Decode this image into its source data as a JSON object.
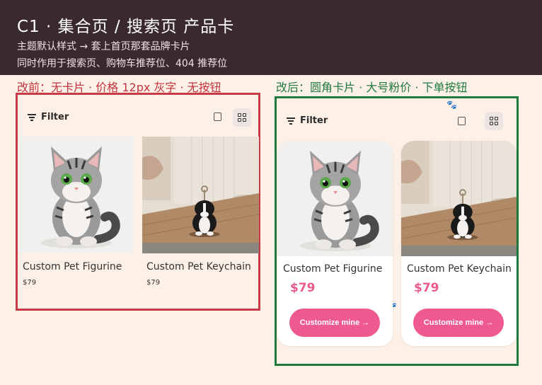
{
  "header": {
    "title": "C1 ·  集合页 / 搜索页 产品卡",
    "subtitle1": "主题默认样式 → 套上首页那套品牌卡片",
    "subtitle2": "同时作用于搜索页、购物车推荐位、404 推荐位"
  },
  "labels": {
    "before": "改前：无卡片 ·  价格 12px 灰字 ·  无按钮",
    "after": "改后：圆角卡片 ·  大号粉价 ·  下单按钮"
  },
  "toolbar": {
    "filter_label": "Filter"
  },
  "products": [
    {
      "name": "Custom Pet Figurine",
      "price": "$79"
    },
    {
      "name": "Custom Pet Keychain",
      "price": "$79"
    }
  ],
  "cta_label": "Customize mine →",
  "colors": {
    "header_bg": "#3a2a30",
    "before_border": "#c63b47",
    "after_border": "#1f7a3f",
    "price_pink": "#ec5a8d",
    "button_pink": "#ee5a8f"
  }
}
